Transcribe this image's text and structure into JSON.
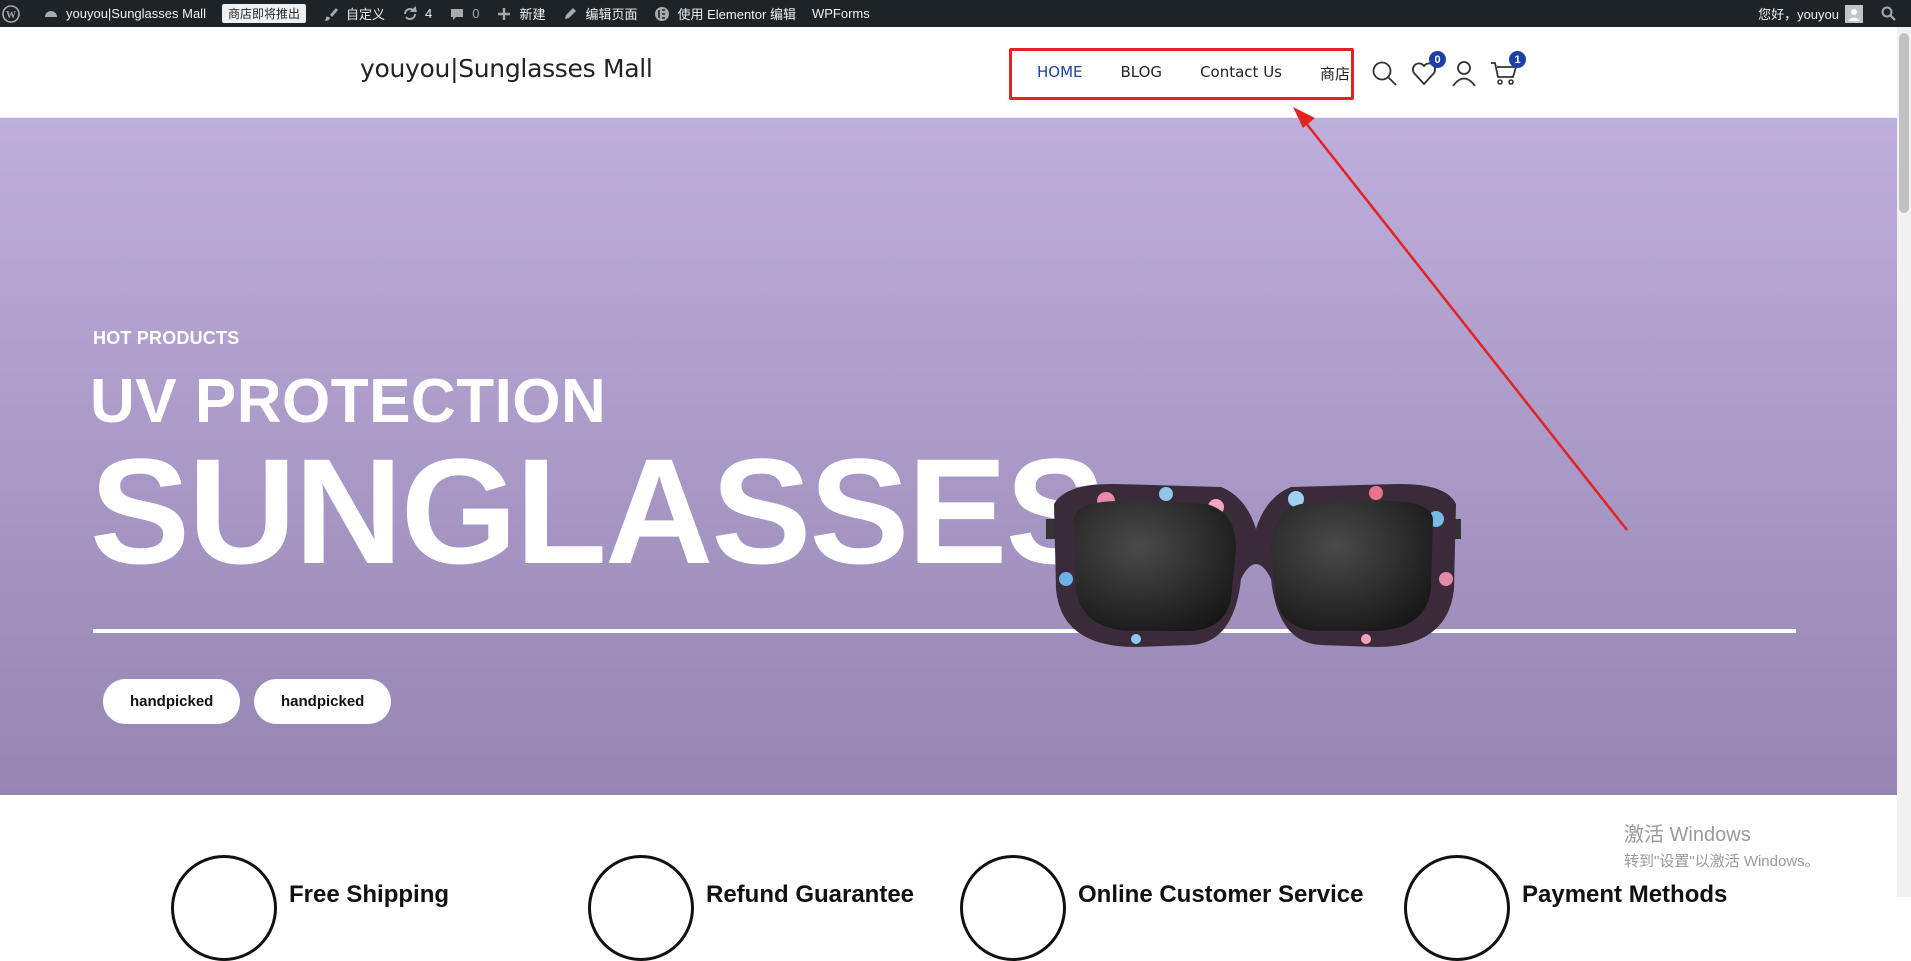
{
  "adminbar": {
    "site_name": "youyou|Sunglasses Mall",
    "badge": "商店即将推出",
    "customize": "自定义",
    "updates_count": "4",
    "comments_count": "0",
    "new": "新建",
    "edit_page": "编辑页面",
    "elementor": "使用 Elementor 编辑",
    "wpforms": "WPForms",
    "greeting": "您好，youyou"
  },
  "header": {
    "site_title": "youyou|Sunglasses Mall",
    "nav": [
      "HOME",
      "BLOG",
      "Contact Us",
      "商店"
    ],
    "wishlist_count": "0",
    "cart_count": "1"
  },
  "hero": {
    "kicker": "HOT PRODUCTS",
    "headline": "UV PROTECTION",
    "title": "SUNGLASSES",
    "tags": [
      "handpicked",
      "handpicked"
    ]
  },
  "features": [
    {
      "title": "Free Shipping"
    },
    {
      "title": "Refund Guarantee"
    },
    {
      "title": "Online Customer Service"
    },
    {
      "title": "Payment Methods"
    }
  ],
  "watermark": {
    "line1": "激活 Windows",
    "line2": "转到\"设置\"以激活 Windows。"
  },
  "colors": {
    "accent": "#1f3fa8",
    "highlight": "#e52222",
    "hero_top": "#bdaedb",
    "hero_bottom": "#9585b3"
  }
}
